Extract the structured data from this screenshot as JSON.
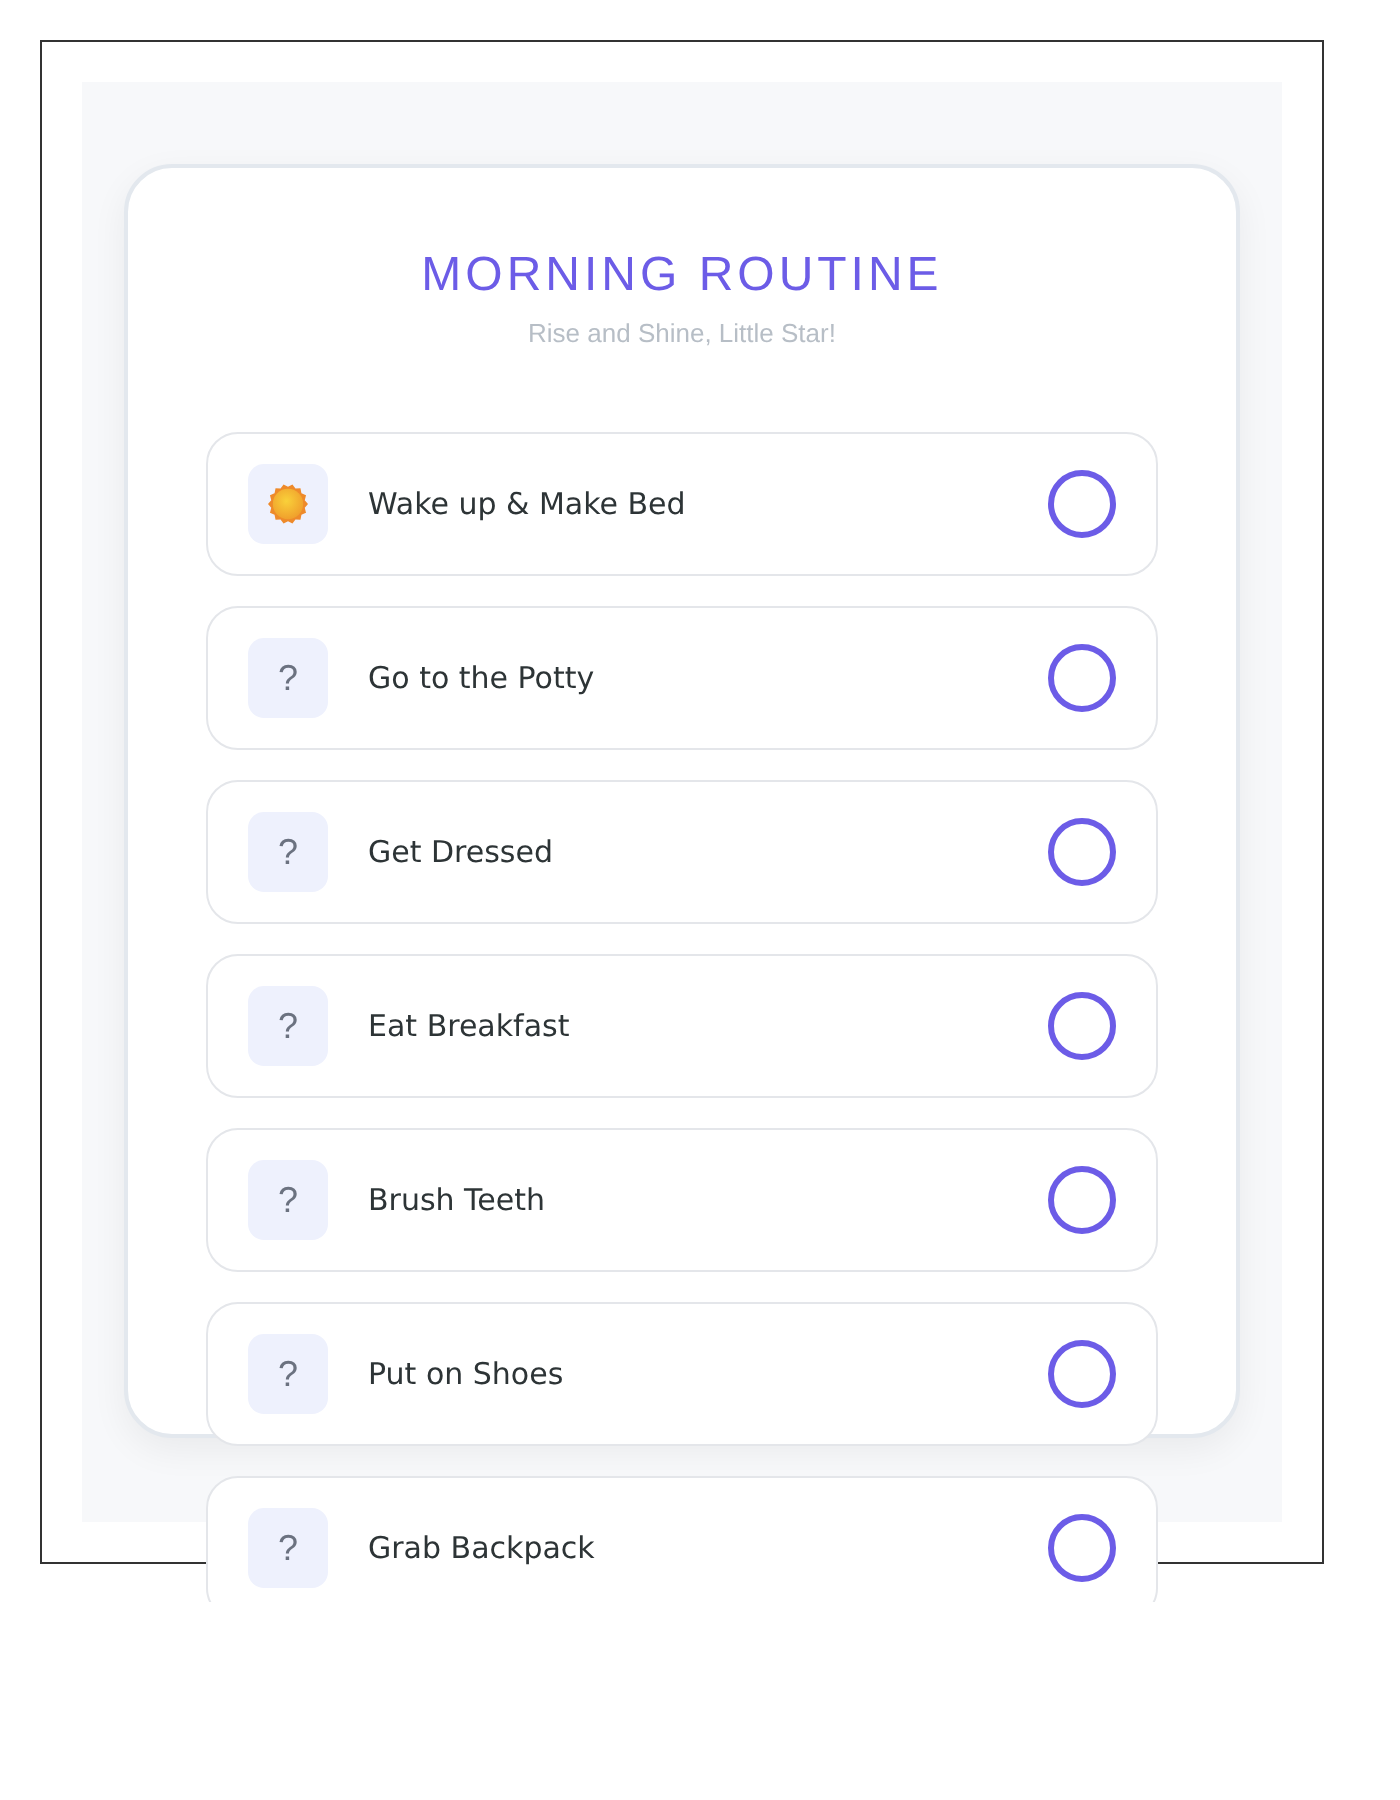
{
  "title": "MORNING ROUTINE",
  "subtitle": "Rise and Shine, Little Star!",
  "tasks": [
    {
      "label": "Wake up & Make Bed",
      "icon": {
        "kind": "sun"
      },
      "checked": false
    },
    {
      "label": "Go to the Potty",
      "icon": {
        "kind": "glyph",
        "glyph": "?"
      },
      "checked": false
    },
    {
      "label": "Get Dressed",
      "icon": {
        "kind": "glyph",
        "glyph": "?"
      },
      "checked": false
    },
    {
      "label": "Eat Breakfast",
      "icon": {
        "kind": "glyph",
        "glyph": "?"
      },
      "checked": false
    },
    {
      "label": "Brush Teeth",
      "icon": {
        "kind": "glyph",
        "glyph": "?"
      },
      "checked": false
    },
    {
      "label": "Put on Shoes",
      "icon": {
        "kind": "glyph",
        "glyph": "?"
      },
      "checked": false
    },
    {
      "label": "Grab Backpack",
      "icon": {
        "kind": "glyph",
        "glyph": "?"
      },
      "checked": false
    }
  ]
}
